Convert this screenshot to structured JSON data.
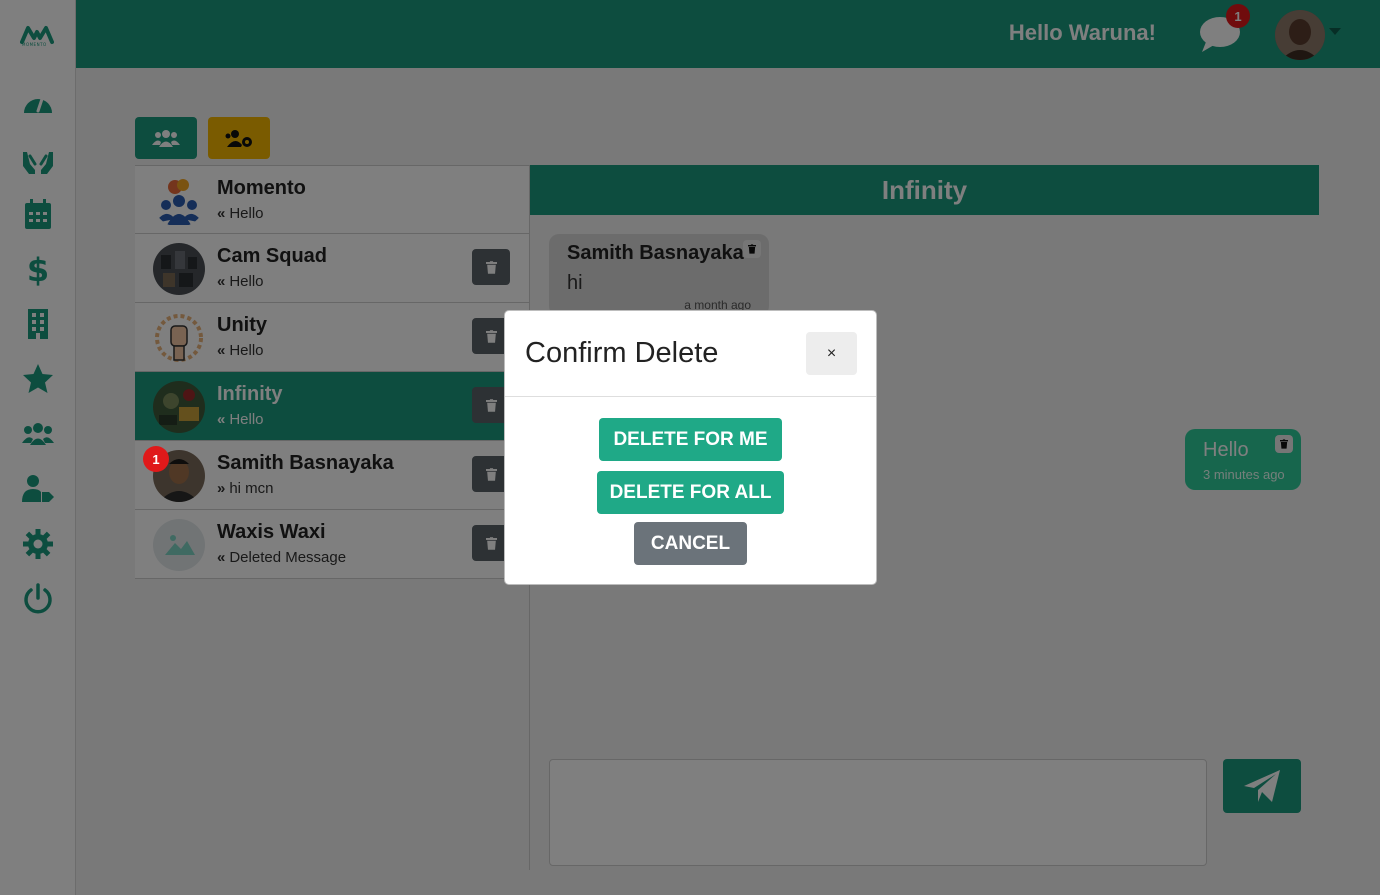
{
  "header": {
    "greeting": "Hello Waruna!",
    "notification_count": "1"
  },
  "sidebar": {
    "logo_text": "MOMENTO",
    "items": [
      {
        "icon": "dashboard-icon"
      },
      {
        "icon": "donation-hands-icon"
      },
      {
        "icon": "calendar-icon"
      },
      {
        "icon": "dollar-icon"
      },
      {
        "icon": "building-icon"
      },
      {
        "icon": "star-icon"
      },
      {
        "icon": "users-icon"
      },
      {
        "icon": "user-tag-icon"
      },
      {
        "icon": "settings-icon"
      },
      {
        "icon": "power-icon"
      }
    ]
  },
  "toolbar": {
    "groups_icon": "users-icon",
    "group_settings_icon": "users-cog-icon"
  },
  "conversations": [
    {
      "name": "Momento",
      "arrow": "«",
      "last": "Hello",
      "has_delete": false
    },
    {
      "name": "Cam Squad",
      "arrow": "«",
      "last": "Hello",
      "has_delete": true
    },
    {
      "name": "Unity",
      "arrow": "«",
      "last": "Hello",
      "has_delete": true
    },
    {
      "name": "Infinity",
      "arrow": "«",
      "last": "Hello",
      "has_delete": true,
      "active": true
    },
    {
      "name": "Samith Basnayaka",
      "arrow": "»",
      "last": "hi mcn",
      "has_delete": true,
      "unread": "1"
    },
    {
      "name": "Waxis Waxi",
      "arrow": "«",
      "last": "Deleted Message",
      "has_delete": true
    }
  ],
  "chat": {
    "title": "Infinity",
    "messages": [
      {
        "sender": "Samith Basnayaka",
        "text": "hi",
        "time": "a month ago",
        "direction": "in"
      },
      {
        "text": "Hello",
        "time": "3 minutes ago",
        "direction": "out"
      }
    ]
  },
  "modal": {
    "title": "Confirm Delete",
    "close_label": "×",
    "delete_for_me": "DELETE FOR ME",
    "delete_for_all": "DELETE FOR ALL",
    "cancel": "CANCEL"
  },
  "colors": {
    "primary": "#1a9b7f",
    "accent": "#f5b700",
    "danger": "#e0191a",
    "secondary": "#6b737a"
  }
}
